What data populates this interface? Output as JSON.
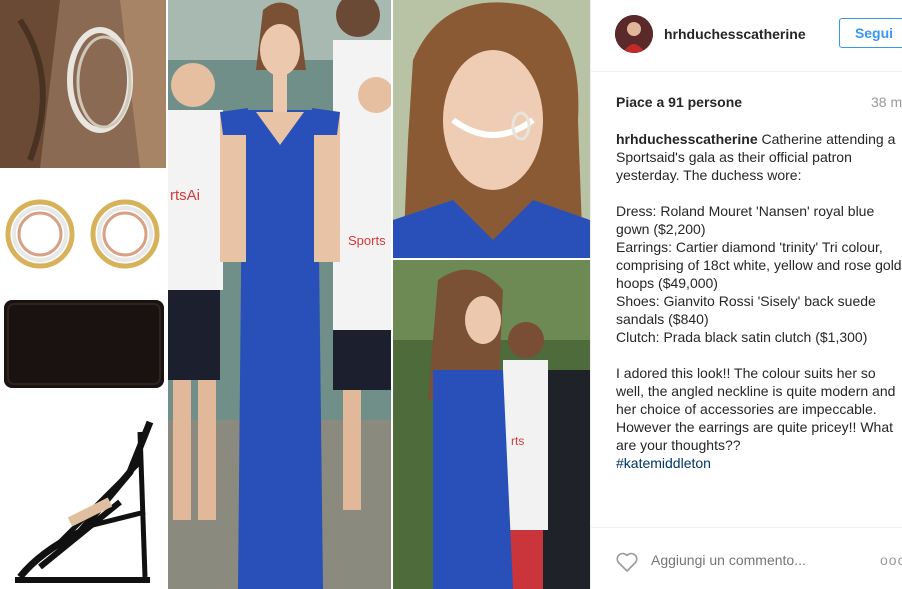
{
  "post": {
    "username": "hrhduchesscatherine",
    "follow_label": "Segui",
    "likes": "Piace a 91 persone",
    "time": "38 m",
    "caption_author": "hrhduchesscatherine",
    "caption_intro": "Catherine attending a Sportsaid's gala as their official patron yesterday. The duchess wore:",
    "items": [
      "Dress: Roland Mouret 'Nansen' royal blue gown ($2,200)",
      "Earrings: Cartier diamond 'trinity' Tri colour, comprising of 18ct white, yellow and rose gold hoops ($49,000)",
      "Shoes: Gianvito Rossi 'Sisely' back suede sandals ($840)",
      "Clutch: Prada black satin clutch ($1,300)"
    ],
    "comment_text": "I adored this look!! The colour suits her so well, the angled neckline is quite modern and her choice of accessories are impeccable. However the earrings are quite pricey!! What are your thoughts??",
    "hashtag": "#katemiddleton",
    "comment_placeholder": "Aggiungi un commento...",
    "more_label": "ooo"
  },
  "photo_text": {
    "shirt_text_1": "rtsAi",
    "shirt_text_2": "Sports",
    "shirt_text_3": "rts"
  },
  "colors": {
    "accent": "#3897f0",
    "dress_blue": "#2850b8",
    "text": "#262626",
    "muted": "#999999"
  },
  "icons": {
    "heart": "heart-outline-icon",
    "more": "ellipsis-icon"
  }
}
